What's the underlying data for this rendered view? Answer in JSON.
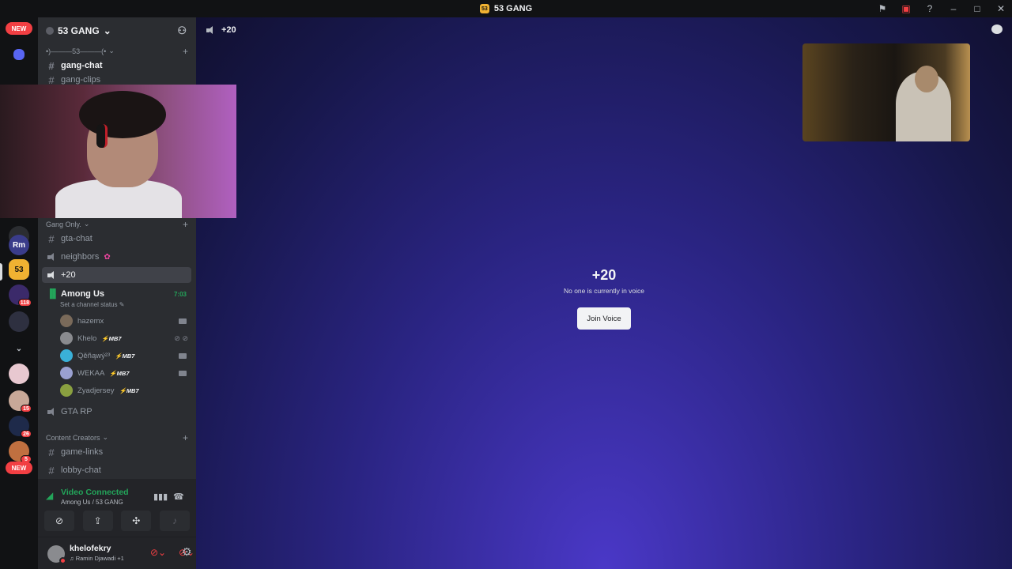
{
  "window": {
    "title": "53 GANG",
    "server_icon_text": "53"
  },
  "guilds": {
    "new_label_top": "NEW",
    "new_label_bottom": "NEW",
    "items": [
      {
        "text": "",
        "badge": ""
      },
      {
        "text": "Rm",
        "badge": ""
      },
      {
        "text": "53",
        "badge": ""
      },
      {
        "text": "",
        "badge": "118"
      },
      {
        "text": "",
        "badge": ""
      },
      {
        "text": "",
        "badge": ""
      },
      {
        "text": "",
        "badge": ""
      },
      {
        "text": "",
        "badge": "15"
      },
      {
        "text": "",
        "badge": "26"
      },
      {
        "text": "",
        "badge": "5"
      }
    ]
  },
  "server": {
    "name": "53 GANG"
  },
  "channels": {
    "category_top": "•)———53———(•",
    "gang_chat": "gang-chat",
    "gang_clips": "gang-clips",
    "category_gang": "Gang Only.",
    "gta_chat": "gta-chat",
    "neighbors": "neighbors",
    "neighbors_emoji": "✿",
    "plus20": "+20",
    "among_us": "Among Us",
    "among_us_time": "7:03",
    "among_us_status": "Set a channel status",
    "voice_users": [
      {
        "name": "hazemx",
        "tag": ""
      },
      {
        "name": "Khelo",
        "tag": "MB7"
      },
      {
        "name": "Qěñąwý²³",
        "tag": "MB7"
      },
      {
        "name": "WEKAA",
        "tag": "MB7"
      },
      {
        "name": "Zyadjersey",
        "tag": "MB7"
      }
    ],
    "gta_rp": "GTA RP",
    "category_creators": "Content Creators",
    "game_links": "game-links",
    "lobby_chat": "lobby-chat"
  },
  "voice_panel": {
    "status": "Video Connected",
    "location": "Among Us / 53 GANG"
  },
  "user": {
    "name": "khelofekry",
    "activity": "♫ Ramin Djawadi +1"
  },
  "main": {
    "header_title": "+20",
    "channel_name": "+20",
    "empty_text": "No one is currently in voice",
    "join_label": "Join Voice"
  },
  "colors": {
    "accent_green": "#23a55a",
    "danger_red": "#f23f43",
    "background_primary": "#2b2d31"
  }
}
